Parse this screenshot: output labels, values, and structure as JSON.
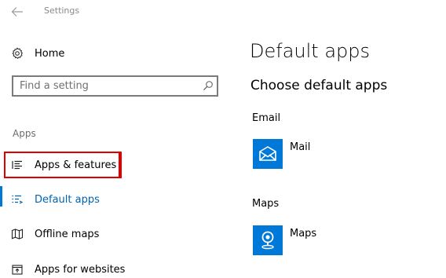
{
  "window": {
    "title": "Settings",
    "back_icon": "arrow-left-icon"
  },
  "sidebar": {
    "home": {
      "label": "Home",
      "icon": "gear-icon"
    },
    "search": {
      "placeholder": "Find a setting",
      "icon": "search-icon"
    },
    "section_heading": "Apps",
    "items": [
      {
        "label": "Apps & features",
        "icon": "list-icon",
        "active": false,
        "highlighted": true
      },
      {
        "label": "Default apps",
        "icon": "default-list-icon",
        "active": true,
        "highlighted": false
      },
      {
        "label": "Offline maps",
        "icon": "map-icon",
        "active": false,
        "highlighted": false
      },
      {
        "label": "Apps for websites",
        "icon": "open-external-icon",
        "active": false,
        "highlighted": false
      }
    ]
  },
  "main": {
    "title": "Default apps",
    "subheading": "Choose default apps",
    "categories": [
      {
        "label": "Email",
        "app": {
          "name": "Mail",
          "icon": "mail-icon"
        }
      },
      {
        "label": "Maps",
        "app": {
          "name": "Maps",
          "icon": "map-pin-icon"
        }
      }
    ]
  },
  "colors": {
    "accent": "#0078d7",
    "active_text": "#0063b1",
    "highlight": "#e00000",
    "muted_text": "#8a8a8a"
  }
}
